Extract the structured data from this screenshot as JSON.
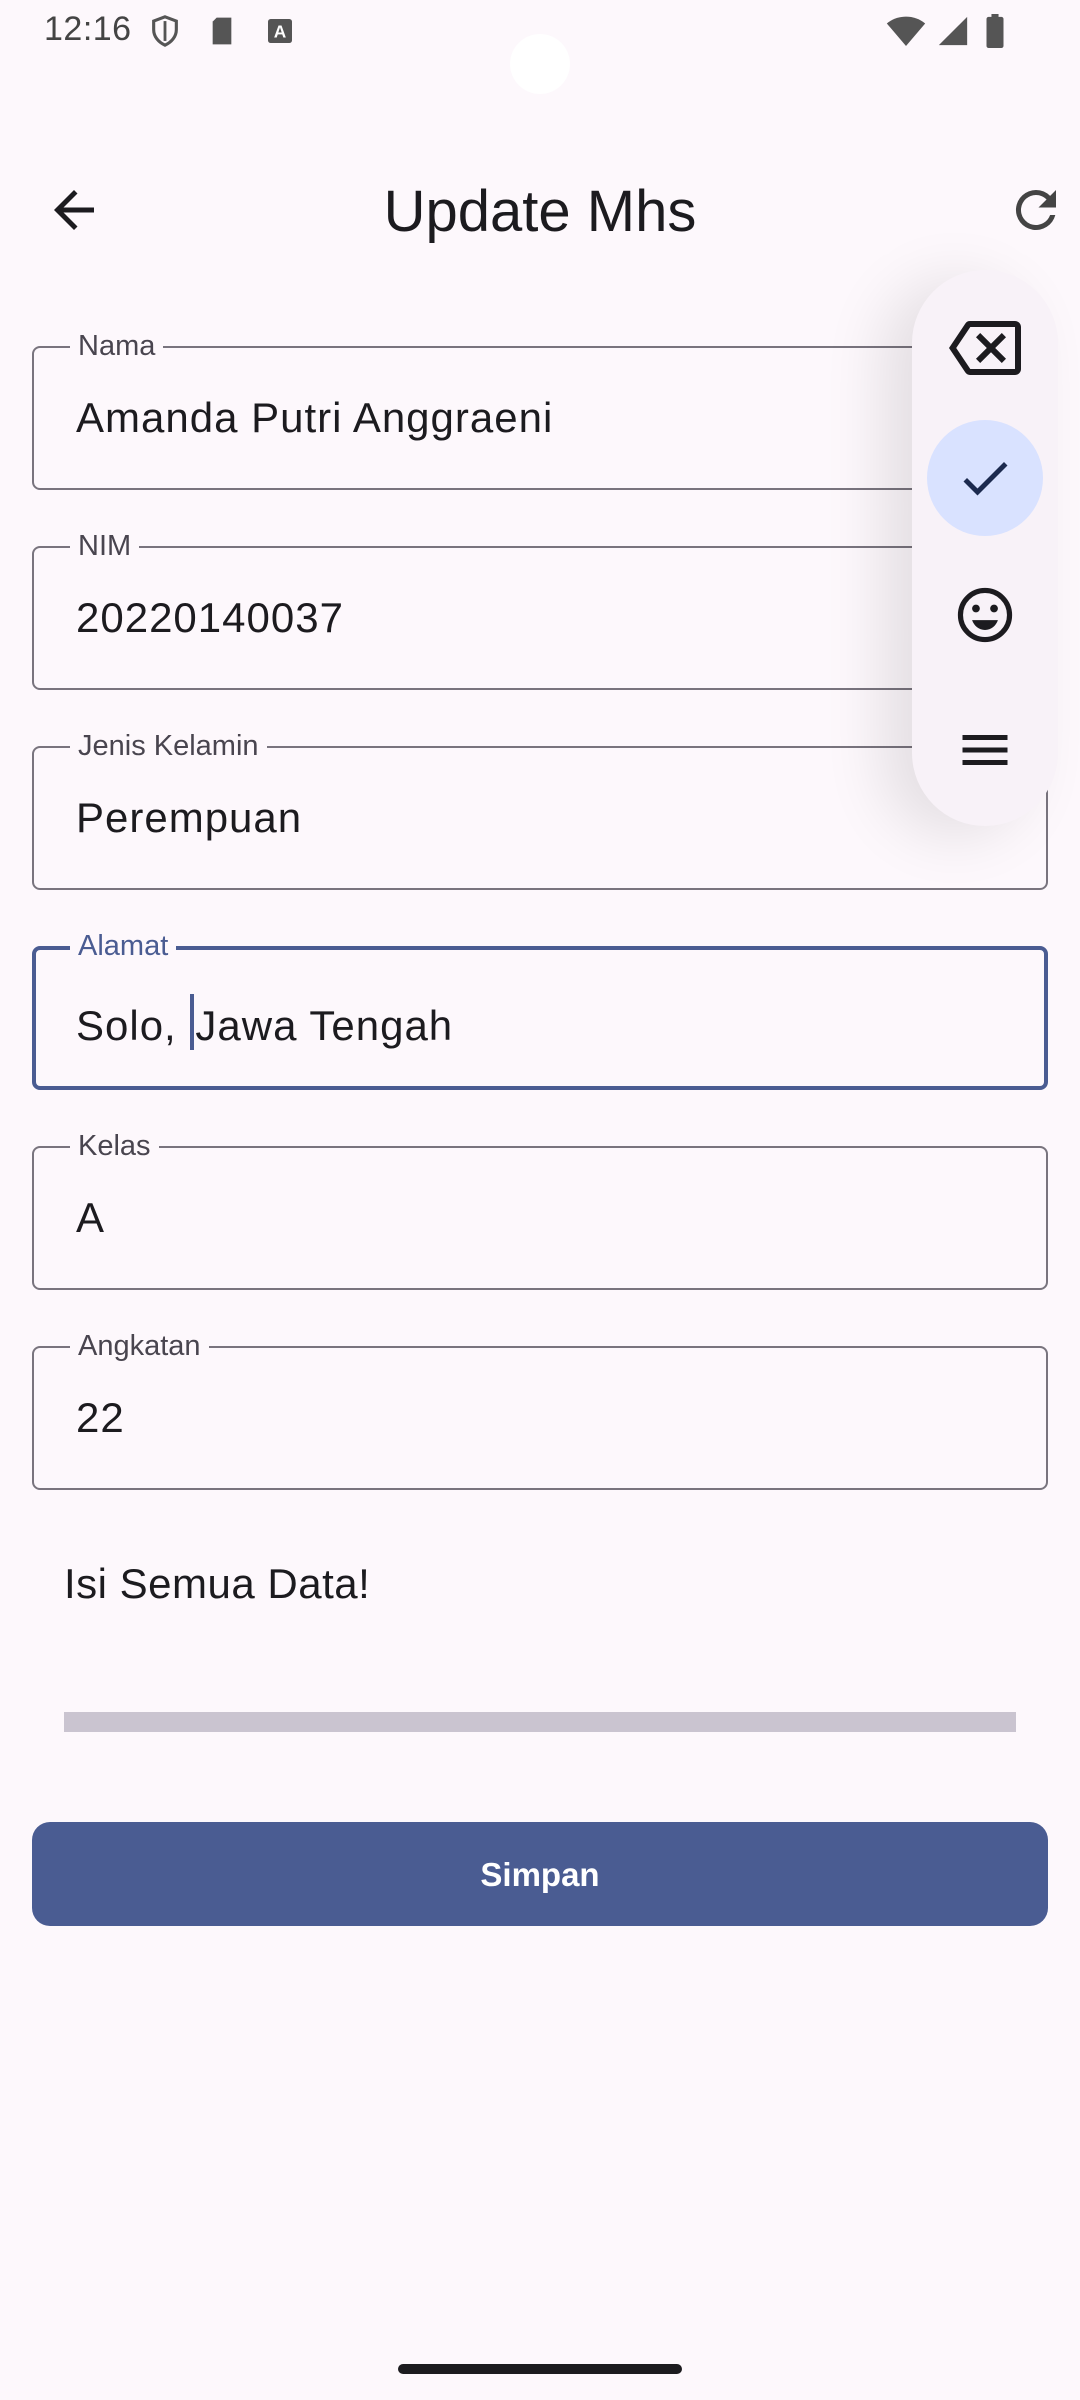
{
  "status_bar": {
    "time": "12:16",
    "icons": [
      "shield-icon",
      "sd-card-icon",
      "keyboard-a-icon",
      "wifi-icon",
      "cell-signal-icon",
      "battery-icon"
    ]
  },
  "app_bar": {
    "title": "Update Mhs",
    "back_icon": "arrow-back-icon",
    "refresh_icon": "refresh-icon"
  },
  "form": {
    "fields": [
      {
        "label": "Nama",
        "value": "Amanda Putri Anggraeni"
      },
      {
        "label": "NIM",
        "value": "20220140037"
      },
      {
        "label": "Jenis Kelamin",
        "value": "Perempuan"
      },
      {
        "label": "Alamat",
        "value_before_cursor": "Solo, ",
        "value_after_cursor": "Jawa Tengah",
        "focused": true
      },
      {
        "label": "Kelas",
        "value": "A"
      },
      {
        "label": "Angkatan",
        "value": "22"
      }
    ],
    "message": "Isi Semua Data!",
    "progress": 0,
    "save_label": "Simpan"
  },
  "floating_toolbar": {
    "items": [
      "backspace-icon",
      "check-icon",
      "emoji-icon",
      "menu-icon"
    ],
    "selected": "check-icon"
  },
  "colors": {
    "primary": "#4a5c92",
    "background": "#fdf8fc",
    "outline": "#79747e",
    "selected_chip": "#d9e2ff"
  }
}
